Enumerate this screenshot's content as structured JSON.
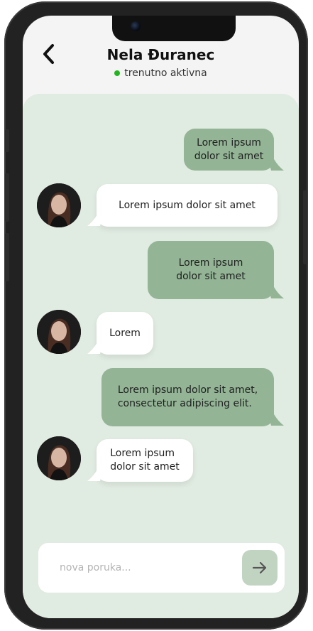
{
  "header": {
    "contact_name": "Nela Đuranec",
    "status_text": "trenutno aktivna",
    "status_color": "#22b61e"
  },
  "messages": [
    {
      "direction": "outgoing",
      "text_lines": [
        "Lorem ipsum",
        "dolor sit amet"
      ]
    },
    {
      "direction": "incoming",
      "text_lines": [
        "Lorem ipsum dolor sit amet"
      ]
    },
    {
      "direction": "outgoing",
      "text_lines": [
        "Lorem ipsum",
        "dolor sit amet"
      ]
    },
    {
      "direction": "incoming",
      "text_lines": [
        "Lorem"
      ]
    },
    {
      "direction": "outgoing",
      "text_lines": [
        "Lorem ipsum dolor sit amet,",
        "consectetur adipiscing elit."
      ]
    },
    {
      "direction": "incoming",
      "text_lines": [
        "Lorem ipsum",
        "dolor sit amet"
      ]
    }
  ],
  "composer": {
    "placeholder": "nova poruka...",
    "send_icon": "arrow-right-icon"
  },
  "icons": {
    "back": "chevron-left-icon"
  },
  "colors": {
    "outgoing_bubble": "#93b495",
    "incoming_bubble": "#ffffff",
    "chat_background": "#e0ebe1",
    "send_button": "#c1d4c2"
  }
}
